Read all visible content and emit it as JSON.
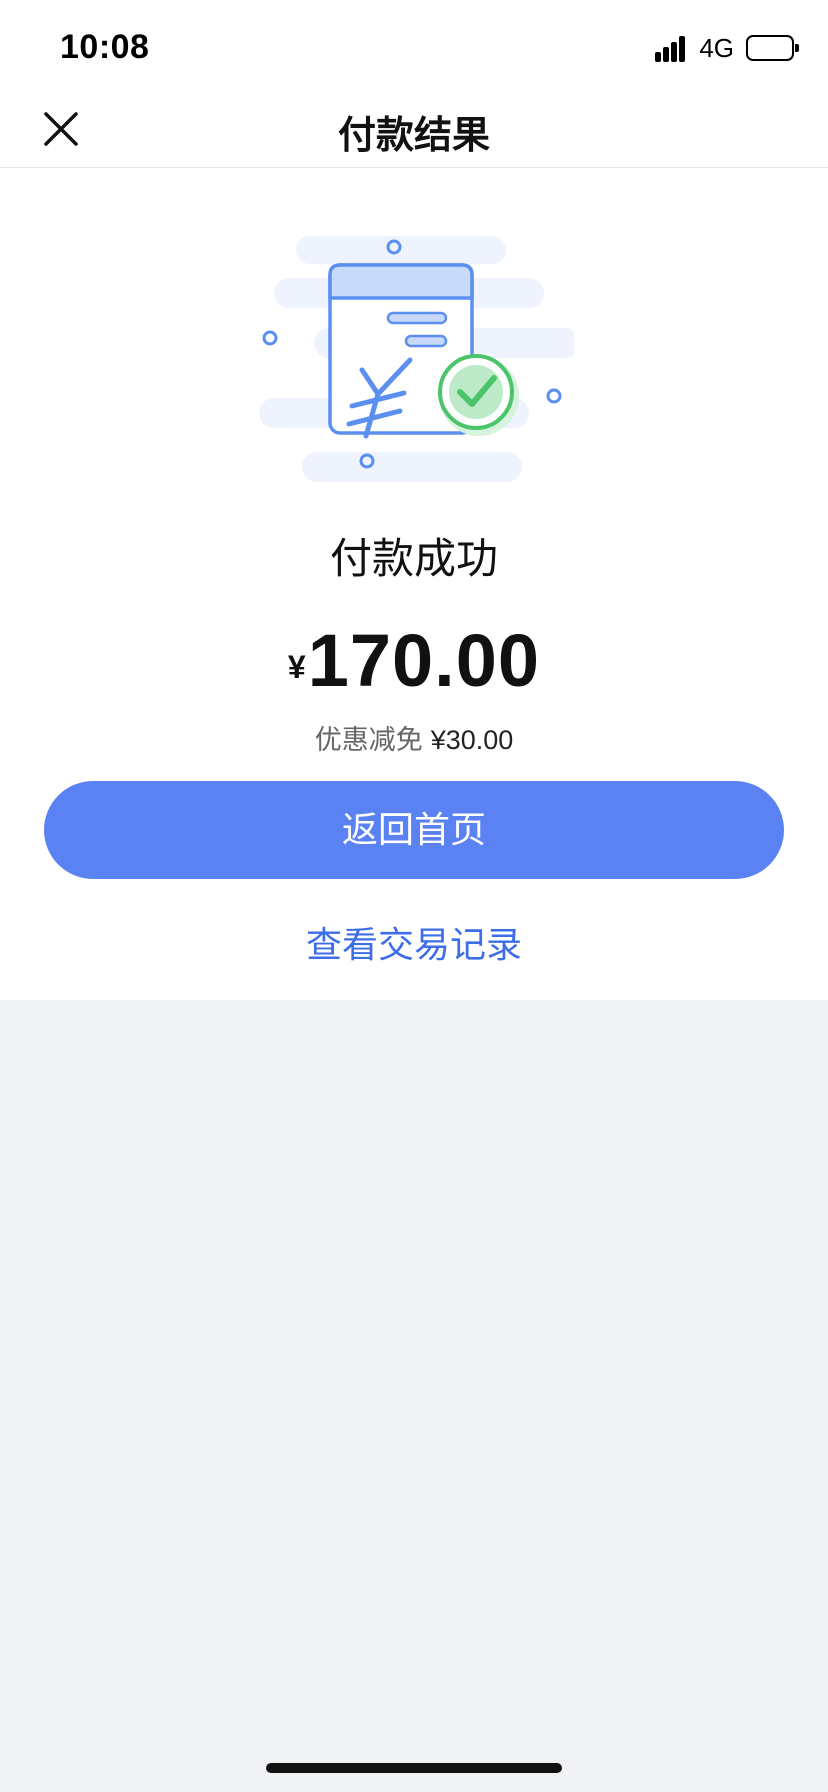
{
  "status_bar": {
    "time": "10:08",
    "network": "4G",
    "icons": [
      "signal-icon",
      "battery-icon"
    ]
  },
  "nav": {
    "title": "付款结果",
    "close_icon": "close-icon"
  },
  "result": {
    "illustration_icon": "payment-success-illustration",
    "status_text": "付款成功",
    "amount_currency": "¥",
    "amount_value": "170.00",
    "discount_label": "优惠减免",
    "discount_value": "¥30.00"
  },
  "actions": {
    "home_button_label": "返回首页",
    "history_link_label": "查看交易记录"
  },
  "colors": {
    "primary_button": "#5b82f3",
    "link": "#3d6ee8",
    "success_green": "#4cc46a",
    "illustration_blue": "#5b8ff0",
    "page_background": "#f1f2f6"
  }
}
